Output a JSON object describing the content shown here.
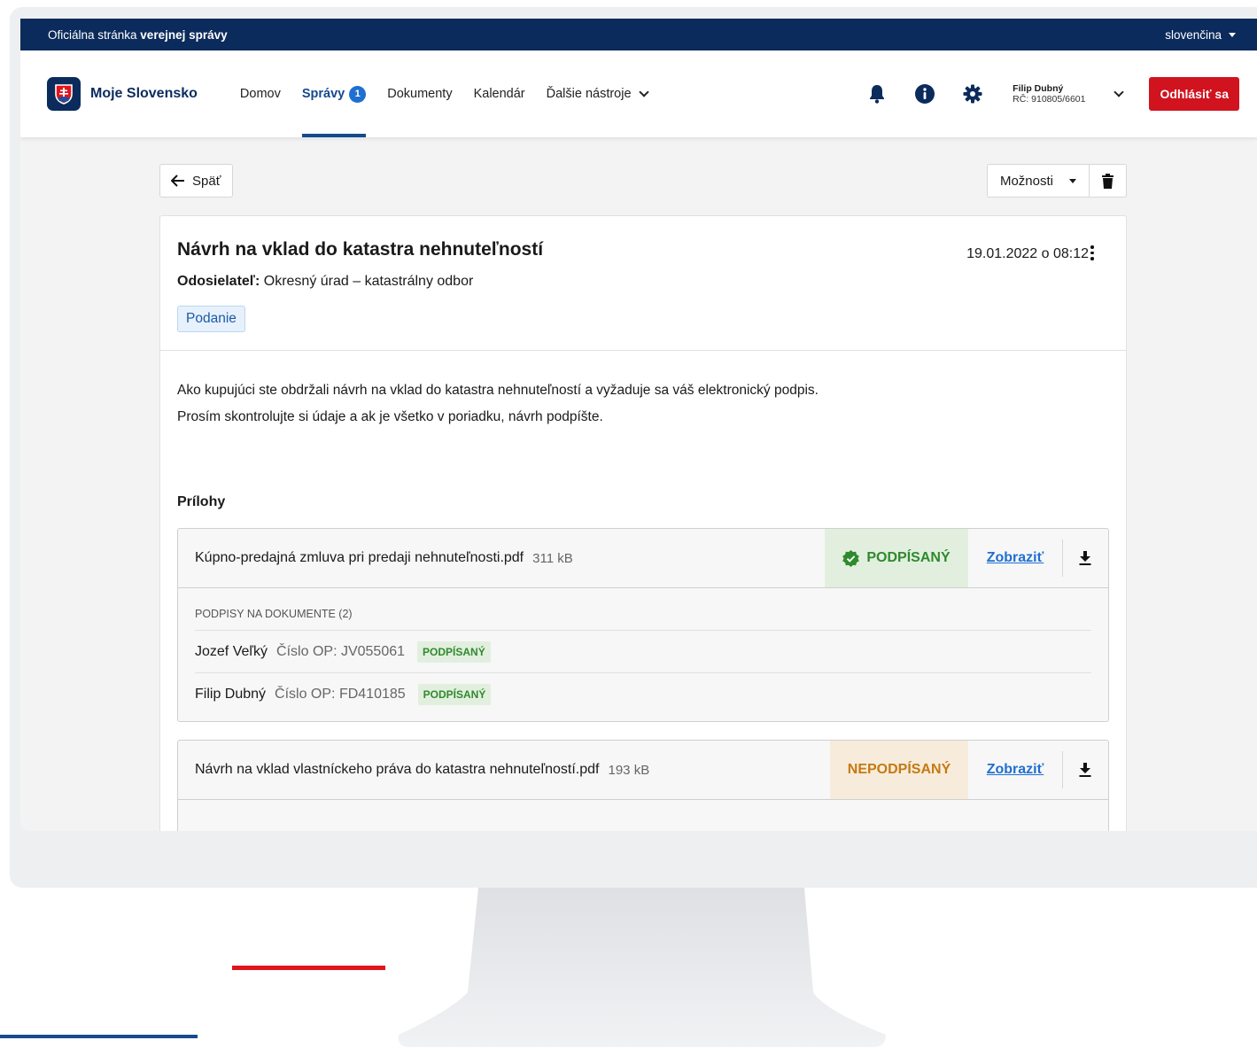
{
  "govbar": {
    "official_prefix": "Oficiálna stránka ",
    "official_strong": "verejnej správy",
    "language": "slovenčina"
  },
  "header": {
    "brand": "Moje Slovensko",
    "nav": [
      {
        "label": "Domov"
      },
      {
        "label": "Správy",
        "badge": "1"
      },
      {
        "label": "Dokumenty"
      },
      {
        "label": "Kalendár"
      },
      {
        "label": "Ďalšie nástroje"
      }
    ],
    "icons": [
      "bell-icon",
      "info-icon",
      "gear-icon"
    ],
    "user_name": "Filip Dubný",
    "user_rc": "RČ: 910805/6601",
    "logout": "Odhlásiť sa",
    "accent_color": "#0b2b5c",
    "logout_color": "#d0131f"
  },
  "toolbar": {
    "back": "Späť",
    "options": "Možnosti"
  },
  "message": {
    "title": "Návrh na vklad do katastra nehnuteľností",
    "date": "19.01.2022 o 08:12",
    "sender_label": "Odosielateľ:",
    "sender_value": " Okresný úrad – katastrálny odbor",
    "tag": "Podanie",
    "body": "Ako kupujúci ste obdržali návrh na vklad do katastra nehnuteľností a vyžaduje sa váš elektronický podpis. Prosím skontrolujte si údaje a ak je všetko v poriadku, návrh podpíšte."
  },
  "attachments": {
    "title": "Prílohy",
    "items": [
      {
        "name": "Kúpno-predajná zmluva pri predaji nehnuteľnosti.pdf",
        "size": "311 kB",
        "status": "PODPÍSANÝ",
        "view": "Zobraziť",
        "signatures_head": "PODPISY NA DOKUMENTE (2)",
        "signatures": [
          {
            "name": "Jozef Veľký",
            "op": "Číslo OP: JV055061",
            "status": "PODPÍSANÝ"
          },
          {
            "name": "Filip Dubný",
            "op": "Číslo OP: FD410185",
            "status": "PODPÍSANÝ"
          }
        ]
      },
      {
        "name": "Návrh na vklad vlastníckeho práva do katastra nehnuteľností.pdf",
        "size": "193 kB",
        "status": "NEPODPÍSANÝ",
        "view": "Zobraziť"
      }
    ]
  }
}
